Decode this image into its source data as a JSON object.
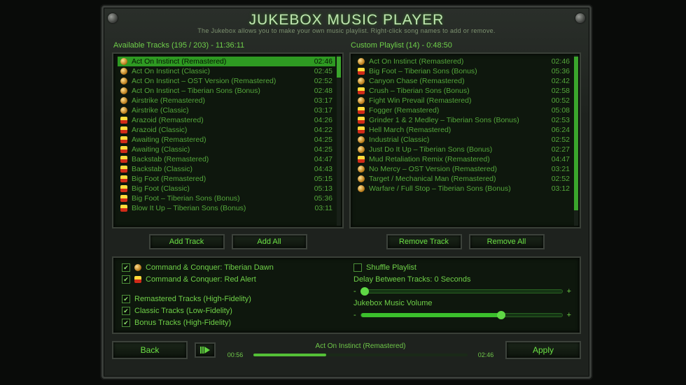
{
  "title": "JUKEBOX MUSIC PLAYER",
  "subtitle": "The Jukebox allows you to make your own music playlist. Right-click song names to add or remove.",
  "available": {
    "header": "Available Tracks (195 / 203) - 11:36:11",
    "tracks": [
      {
        "name": "Act On Instinct (Remastered)",
        "time": "02:46",
        "faction": "td",
        "selected": true
      },
      {
        "name": "Act On Instinct (Classic)",
        "time": "02:45",
        "faction": "td"
      },
      {
        "name": "Act On Instinct – OST Version (Remastered)",
        "time": "02:52",
        "faction": "td"
      },
      {
        "name": "Act On Instinct – Tiberian Sons (Bonus)",
        "time": "02:48",
        "faction": "td"
      },
      {
        "name": "Airstrike (Remastered)",
        "time": "03:17",
        "faction": "td"
      },
      {
        "name": "Airstrike (Classic)",
        "time": "03:17",
        "faction": "td"
      },
      {
        "name": "Arazoid (Remastered)",
        "time": "04:26",
        "faction": "ra"
      },
      {
        "name": "Arazoid (Classic)",
        "time": "04:22",
        "faction": "ra"
      },
      {
        "name": "Awaiting (Remastered)",
        "time": "04:25",
        "faction": "ra"
      },
      {
        "name": "Awaiting (Classic)",
        "time": "04:25",
        "faction": "ra"
      },
      {
        "name": "Backstab (Remastered)",
        "time": "04:47",
        "faction": "ra"
      },
      {
        "name": "Backstab (Classic)",
        "time": "04:43",
        "faction": "ra"
      },
      {
        "name": "Big Foot (Remastered)",
        "time": "05:15",
        "faction": "ra"
      },
      {
        "name": "Big Foot (Classic)",
        "time": "05:13",
        "faction": "ra"
      },
      {
        "name": "Big Foot – Tiberian Sons (Bonus)",
        "time": "05:36",
        "faction": "ra"
      },
      {
        "name": "Blow It Up – Tiberian Sons (Bonus)",
        "time": "03:11",
        "faction": "ra"
      }
    ],
    "buttons": {
      "add_track": "Add Track",
      "add_all": "Add All"
    }
  },
  "playlist": {
    "header": "Custom Playlist (14) - 0:48:50",
    "tracks": [
      {
        "name": "Act On Instinct (Remastered)",
        "time": "02:46",
        "faction": "td"
      },
      {
        "name": "Big Foot – Tiberian Sons (Bonus)",
        "time": "05:36",
        "faction": "ra"
      },
      {
        "name": "Canyon Chase (Remastered)",
        "time": "02:42",
        "faction": "td"
      },
      {
        "name": "Crush – Tiberian Sons (Bonus)",
        "time": "02:58",
        "faction": "ra"
      },
      {
        "name": "Fight Win Prevail (Remastered)",
        "time": "00:52",
        "faction": "td"
      },
      {
        "name": "Fogger (Remastered)",
        "time": "05:08",
        "faction": "ra"
      },
      {
        "name": "Grinder 1 & 2 Medley – Tiberian Sons (Bonus)",
        "time": "02:53",
        "faction": "ra"
      },
      {
        "name": "Hell March (Remastered)",
        "time": "06:24",
        "faction": "ra"
      },
      {
        "name": "Industrial (Classic)",
        "time": "02:52",
        "faction": "td"
      },
      {
        "name": "Just Do It Up – Tiberian Sons (Bonus)",
        "time": "02:27",
        "faction": "td"
      },
      {
        "name": "Mud Retaliation Remix (Remastered)",
        "time": "04:47",
        "faction": "ra"
      },
      {
        "name": "No Mercy – OST Version (Remastered)",
        "time": "03:21",
        "faction": "td"
      },
      {
        "name": "Target / Mechanical Man (Remastered)",
        "time": "02:52",
        "faction": "td"
      },
      {
        "name": "Warfare / Full Stop – Tiberian Sons (Bonus)",
        "time": "03:12",
        "faction": "td"
      }
    ],
    "buttons": {
      "remove_track": "Remove Track",
      "remove_all": "Remove All"
    }
  },
  "options": {
    "filter_td": "Command & Conquer: Tiberian Dawn",
    "filter_ra": "Command & Conquer: Red Alert",
    "filter_remastered": "Remastered Tracks (High-Fidelity)",
    "filter_classic": "Classic Tracks (Low-Fidelity)",
    "filter_bonus": "Bonus Tracks (High-Fidelity)",
    "shuffle": "Shuffle Playlist",
    "delay_label": "Delay Between Tracks: 0 Seconds",
    "volume_label": "Jukebox Music Volume",
    "slider_minus": "-",
    "slider_plus": "+",
    "delay_value_pct": 2,
    "volume_value_pct": 70,
    "checks": {
      "td": true,
      "ra": true,
      "rem": true,
      "cls": true,
      "bon": true,
      "shuf": false
    }
  },
  "nowplaying": {
    "track": "Act On Instinct (Remastered)",
    "elapsed": "00:56",
    "total": "02:46",
    "progress_pct": 34
  },
  "footer": {
    "back": "Back",
    "apply": "Apply"
  }
}
